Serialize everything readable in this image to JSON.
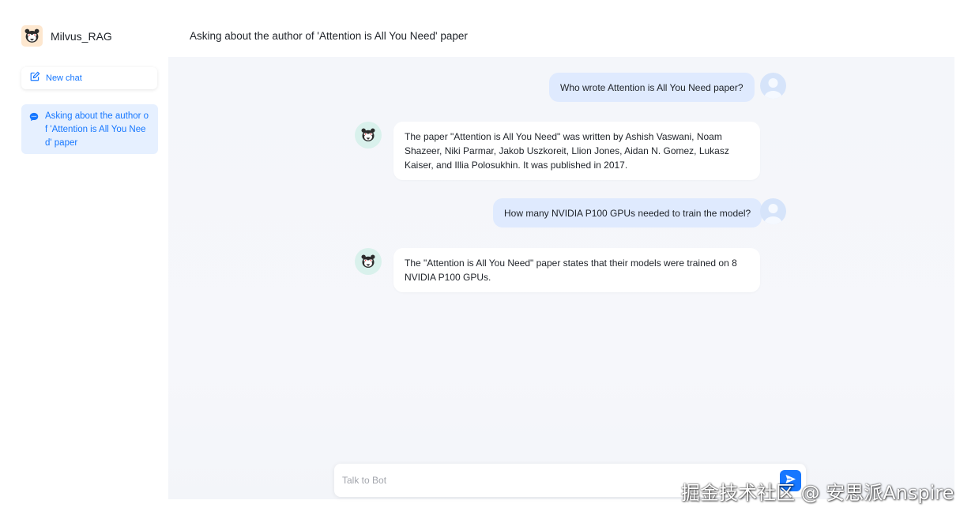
{
  "brand": {
    "name": "Milvus_RAG",
    "logo_icon": "bear-logo-icon"
  },
  "sidebar": {
    "new_chat_label": "New chat",
    "new_chat_icon": "edit-icon",
    "conversations": [
      {
        "label": "Asking about the author of 'Attention is All You Need' paper",
        "icon": "chat-bubble-icon",
        "active": true
      }
    ]
  },
  "main": {
    "title": "Asking about the author of 'Attention is All You Need' paper",
    "messages": [
      {
        "role": "user",
        "text": "Who wrote Attention is All You Need paper?"
      },
      {
        "role": "bot",
        "text": "The paper \"Attention is All You Need\" was written by Ashish Vaswani, Noam Shazeer, Niki Parmar, Jakob Uszkoreit, Llion Jones, Aidan N. Gomez, Lukasz Kaiser, and Illia Polosukhin. It was published in 2017."
      },
      {
        "role": "user",
        "text": "How many NVIDIA P100 GPUs needed to train the model?"
      },
      {
        "role": "bot",
        "text": "The \"Attention is All You Need\" paper states that their models were trained on 8 NVIDIA P100 GPUs."
      }
    ]
  },
  "input": {
    "placeholder": "Talk to Bot",
    "value": "",
    "send_icon": "send-icon"
  },
  "watermark": "掘金技术社区 @ 安思派Anspire",
  "colors": {
    "accent": "#1677ff",
    "user_bubble": "#dfeafe",
    "active_item_bg": "#e6f0ff",
    "chat_bg": "#f4f6fa"
  }
}
